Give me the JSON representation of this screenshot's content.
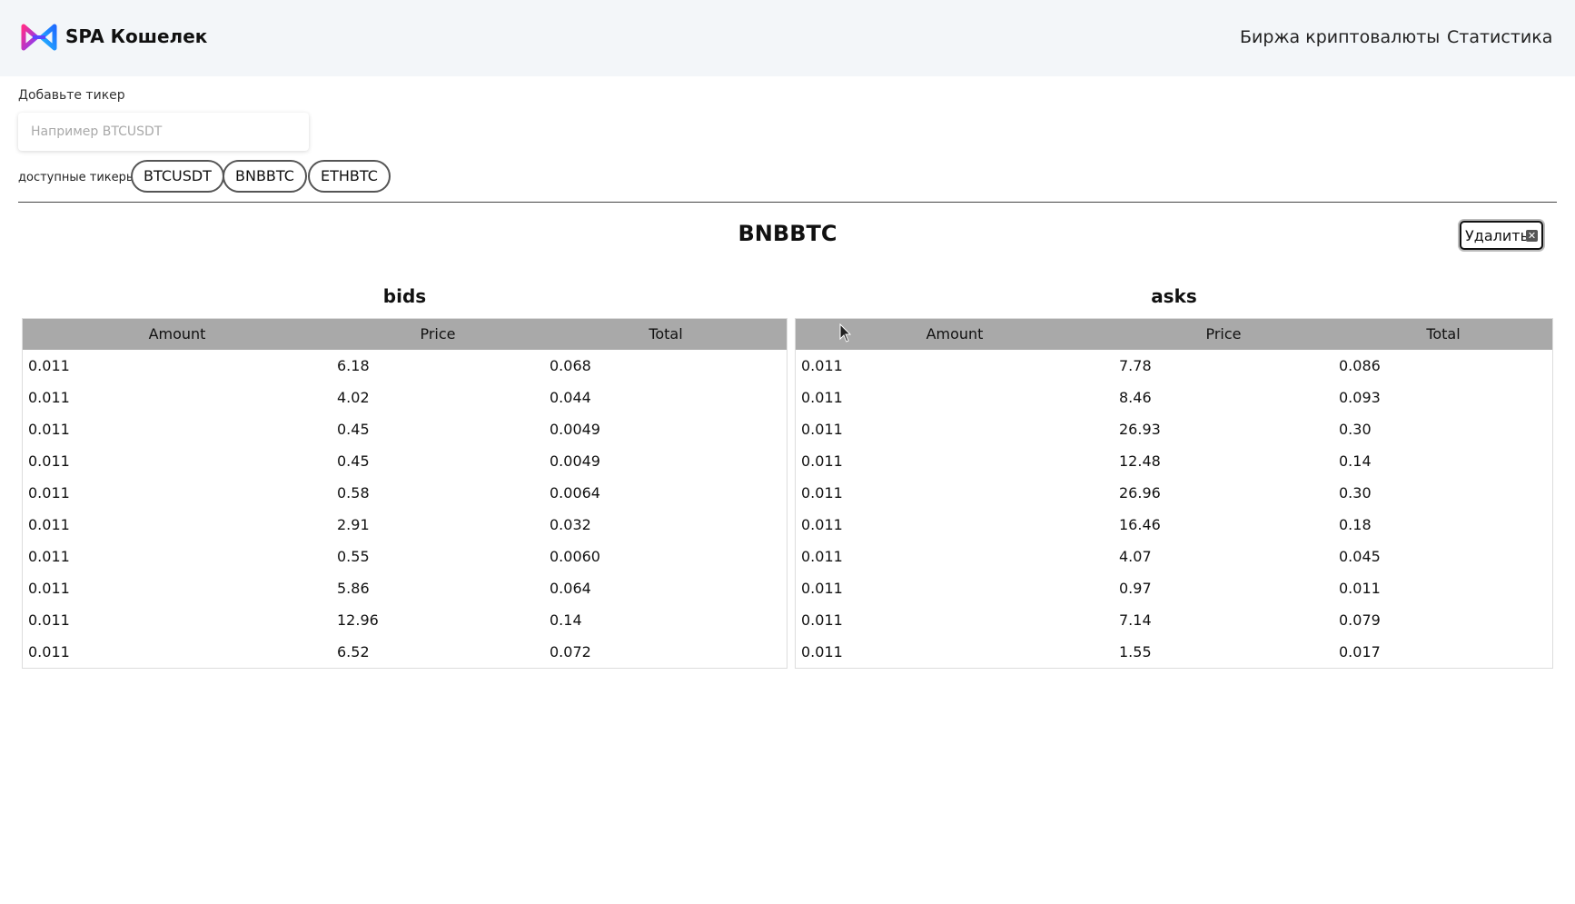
{
  "header": {
    "brand": "SPA Кошелек",
    "nav": [
      "Биржа криптовалюты",
      "Статистика"
    ]
  },
  "add_ticker": {
    "label": "Добавьте тикер",
    "placeholder": "Например BTCUSDT",
    "value": ""
  },
  "available": {
    "label": "доступные тикеры:",
    "tickers": [
      "BTCUSDT",
      "BNBBTC",
      "ETHBTC"
    ]
  },
  "pair": {
    "title": "BNBBTC",
    "delete_label": "Удалить"
  },
  "bids": {
    "title": "bids",
    "columns": [
      "Amount",
      "Price",
      "Total"
    ],
    "rows": [
      [
        "0.011",
        "6.18",
        "0.068"
      ],
      [
        "0.011",
        "4.02",
        "0.044"
      ],
      [
        "0.011",
        "0.45",
        "0.0049"
      ],
      [
        "0.011",
        "0.45",
        "0.0049"
      ],
      [
        "0.011",
        "0.58",
        "0.0064"
      ],
      [
        "0.011",
        "2.91",
        "0.032"
      ],
      [
        "0.011",
        "0.55",
        "0.0060"
      ],
      [
        "0.011",
        "5.86",
        "0.064"
      ],
      [
        "0.011",
        "12.96",
        "0.14"
      ],
      [
        "0.011",
        "6.52",
        "0.072"
      ]
    ]
  },
  "asks": {
    "title": "asks",
    "columns": [
      "Amount",
      "Price",
      "Total"
    ],
    "rows": [
      [
        "0.011",
        "7.78",
        "0.086"
      ],
      [
        "0.011",
        "8.46",
        "0.093"
      ],
      [
        "0.011",
        "26.93",
        "0.30"
      ],
      [
        "0.011",
        "12.48",
        "0.14"
      ],
      [
        "0.011",
        "26.96",
        "0.30"
      ],
      [
        "0.011",
        "16.46",
        "0.18"
      ],
      [
        "0.011",
        "4.07",
        "0.045"
      ],
      [
        "0.011",
        "0.97",
        "0.011"
      ],
      [
        "0.011",
        "7.14",
        "0.079"
      ],
      [
        "0.011",
        "1.55",
        "0.017"
      ]
    ]
  },
  "colors": {
    "header_bg": "#f3f6f9",
    "table_head_bg": "#a9a9a9"
  }
}
